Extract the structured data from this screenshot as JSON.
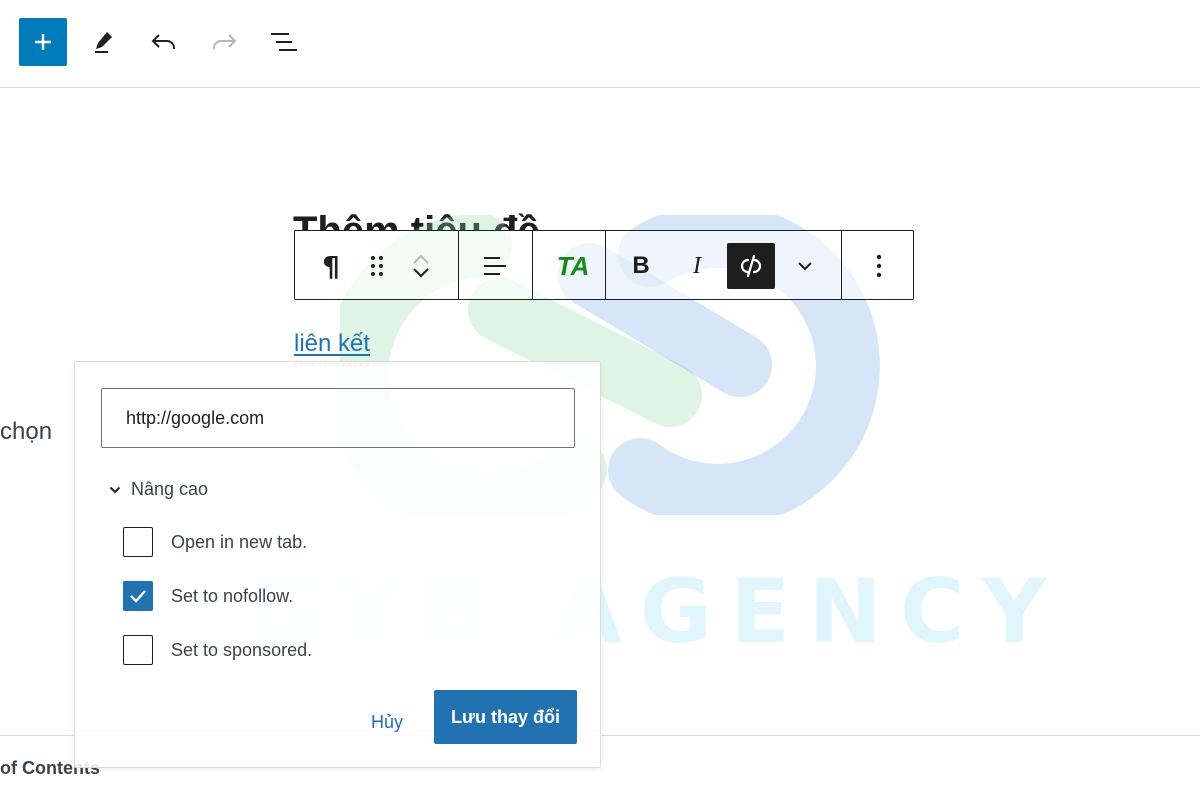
{
  "colors": {
    "accent": "#2271b1",
    "add_button": "#007cba",
    "ta_green": "#1a8a1a"
  },
  "topbar": {
    "icons": [
      "plus-icon",
      "pencil-icon",
      "undo-icon",
      "redo-icon",
      "list-view-icon"
    ]
  },
  "editor": {
    "heading_fragment": "Thêm tiêu đề",
    "link_text": "liên kết",
    "left_fragment": "chọn",
    "bottom_fragment": "of Contents"
  },
  "block_toolbar": {
    "paragraph_symbol": "¶",
    "ta_label": "TA",
    "bold_label": "B",
    "italic_label": "I"
  },
  "link_popover": {
    "url_value": "http://google.com",
    "advanced_label": "Nâng cao",
    "options": [
      {
        "label": "Open in new tab.",
        "checked": false
      },
      {
        "label": "Set to nofollow.",
        "checked": true
      },
      {
        "label": "Set to sponsored.",
        "checked": false
      }
    ],
    "cancel_label": "Hủy",
    "save_label": "Lưu thay đổi"
  },
  "watermark": {
    "text": "GYB AGENCY"
  }
}
